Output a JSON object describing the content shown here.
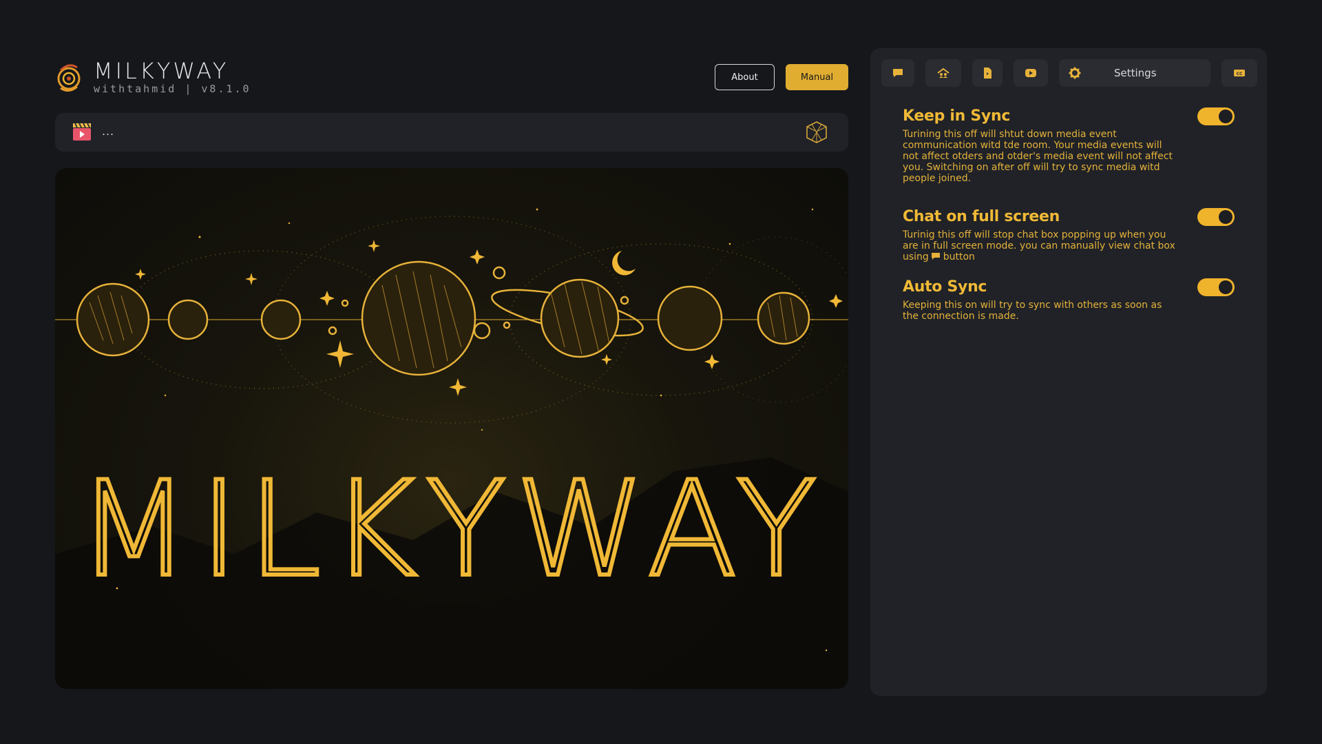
{
  "header": {
    "brand_title": "MILKYWAY",
    "brand_subtitle": "withtahmid | v8.1.0",
    "about_label": "About",
    "manual_label": "Manual"
  },
  "media_bar": {
    "title": "..."
  },
  "video": {
    "title_text": "MILKYWAY"
  },
  "panel": {
    "tabs": {
      "chat_icon": "chat-icon",
      "room_icon": "room-icon",
      "file_icon": "file-icon",
      "youtube_icon": "youtube-icon",
      "settings_label": "Settings",
      "cc_icon": "closed-captions-icon"
    },
    "settings": [
      {
        "title": "Keep in Sync",
        "description": "Turining this off will shtut down media event communication witd tde room. Your media events will not affect otders and otder's media event will not affect you. Switching on after off will try to sync media witd people joined.",
        "enabled": true
      },
      {
        "title": "Chat on full screen",
        "description_before": "Turinig this off will stop chat box popping up when you are in full screen mode. you can manually view chat box using",
        "description_after": "button",
        "enabled": true
      },
      {
        "title": "Auto Sync",
        "description": "Keeping this on will try to sync with others as soon as the connection is made.",
        "enabled": true
      }
    ]
  },
  "colors": {
    "background": "#15171b",
    "panel": "#202227",
    "accent": "#f0b32c",
    "accent_text": "#e4b23a"
  }
}
